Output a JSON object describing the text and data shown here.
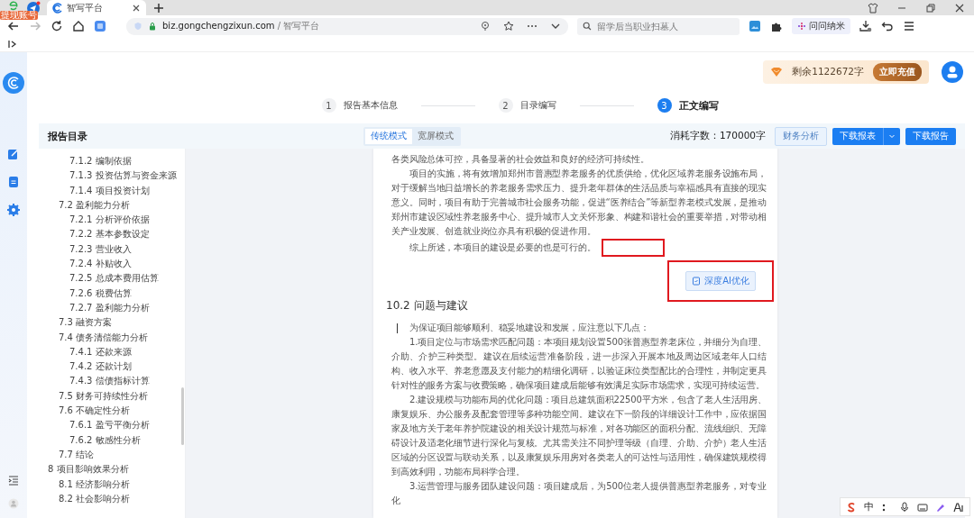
{
  "browser": {
    "badge": "提现账号",
    "tab_title": "智写平台",
    "url_host": "biz.gongchengzixun.com",
    "url_path": " / 智写平台",
    "search": {
      "placeholder": "留学后当职业扫墓人"
    },
    "assistant": "问问纳米"
  },
  "account": {
    "quota": "剩余1122672字",
    "recharge": "立即充值"
  },
  "steps": [
    {
      "number": "1",
      "label": "报告基本信息",
      "selected": false
    },
    {
      "number": "2",
      "label": "目录编写",
      "selected": false
    },
    {
      "number": "3",
      "label": "正文编写",
      "selected": true
    }
  ],
  "toolbar": {
    "title": "报告目录",
    "modes": [
      {
        "label": "传统模式",
        "selected": true
      },
      {
        "label": "宽屏模式",
        "selected": false
      }
    ],
    "usage": "消耗字数：170000字",
    "buttons": [
      {
        "label": "财务分析",
        "kind": "outline"
      },
      {
        "label": "下载报表",
        "kind": "split"
      },
      {
        "label": "下载报告",
        "kind": "primary"
      }
    ]
  },
  "toc": [
    {
      "children": [
        {
          "children": [
            {
              "label": "7.1.2 编制依据"
            },
            {
              "label": "7.1.3 投资估算与资金来源"
            },
            {
              "label": "7.1.4 项目投资计划"
            }
          ]
        },
        {
          "label": "7.2 盈利能力分析",
          "children": [
            {
              "label": "7.2.1 分析评价依据"
            },
            {
              "label": "7.2.2 基本参数设定"
            },
            {
              "label": "7.2.3 营业收入"
            },
            {
              "label": "7.2.4 补贴收入"
            },
            {
              "label": "7.2.5 总成本费用估算"
            },
            {
              "label": "7.2.6 税费估算"
            },
            {
              "label": "7.2.7 盈利能力分析"
            }
          ]
        },
        {
          "label": "7.3 融资方案"
        },
        {
          "label": "7.4 债务清偿能力分析",
          "children": [
            {
              "label": "7.4.1 还款来源"
            },
            {
              "label": "7.4.2 还款计划"
            },
            {
              "label": "7.4.3 偿债指标计算"
            }
          ]
        },
        {
          "label": "7.5 财务可持续性分析"
        },
        {
          "label": "7.6 不确定性分析",
          "children": [
            {
              "label": "7.6.1 盈亏平衡分析"
            },
            {
              "label": "7.6.2 敏感性分析"
            }
          ]
        },
        {
          "label": "7.7 结论"
        }
      ]
    },
    {
      "label": "8 项目影响效果分析",
      "children": [
        {
          "label": "8.1 经济影响分析"
        },
        {
          "label": "8.2 社会影响分析"
        }
      ]
    }
  ],
  "document": {
    "blocks": [
      {
        "kind": "paragraph",
        "indent": false,
        "text": "各类风险总体可控，具备显著的社会效益和良好的经济可持续性。"
      },
      {
        "kind": "paragraph",
        "indent": true,
        "text": "项目的实施，将有效增加郑州市普惠型养老服务的优质供给，优化区域养老服务设施布局，对于缓解当地日益增长的养老服务需求压力、提升老年群体的生活品质与幸福感具有直接的现实意义。同时，项目有助于完善城市社会服务功能，促进“医养结合”等新型养老模式发展，是推动郑州市建设区域性养老服务中心、提升城市人文关怀形象、构建和谐社会的重要举措，对带动相关产业发展、创造就业岗位亦具有积极的促进作用。"
      },
      {
        "kind": "paragraph",
        "indent": true,
        "text": "综上所述，本项目的建设是必要的也是可行的。",
        "marked": true
      },
      {
        "kind": "action",
        "text": "深度AI优化",
        "marked": true
      },
      {
        "kind": "heading",
        "text": "10.2 问题与建议"
      },
      {
        "kind": "paragraph",
        "indent": true,
        "cursor": true,
        "text": "为保证项目能够顺利、稳妥地建设和发展，应注意以下几点："
      },
      {
        "kind": "paragraph",
        "indent": true,
        "text": "1.项目定位与市场需求匹配问题：本项目规划设置500张普惠型养老床位，并细分为自理、介助、介护三种类型。建议在后续运营准备阶段，进一步深入开展本地及周边区域老年人口结构、收入水平、养老意愿及支付能力的精细化调研，以验证床位类型配比的合理性，并制定更具针对性的服务方案与收费策略，确保项目建成后能够有效满足实际市场需求，实现可持续运营。"
      },
      {
        "kind": "paragraph",
        "indent": true,
        "text": "2.建设规模与功能布局的优化问题：项目总建筑面积22500平方米，包含了老人生活用房、康复娱乐、办公服务及配套管理等多种功能空间。建议在下一阶段的详细设计工作中，应依据国家及地方关于老年养护院建设的相关设计规范与标准，对各功能区的面积分配、流线组织、无障碍设计及适老化细节进行深化与复核。尤其需关注不同护理等级（自理、介助、介护）老人生活区域的分区设置与联动关系，以及康复娱乐用房对各类老人的可达性与适用性，确保建筑规模得到高效利用，功能布局科学合理。"
      },
      {
        "kind": "paragraph",
        "indent": true,
        "text": "3.运营管理与服务团队建设问题：项目建成后，为500位老人提供普惠型养老服务，对专业化"
      }
    ]
  },
  "ime": {
    "mode": "中"
  }
}
